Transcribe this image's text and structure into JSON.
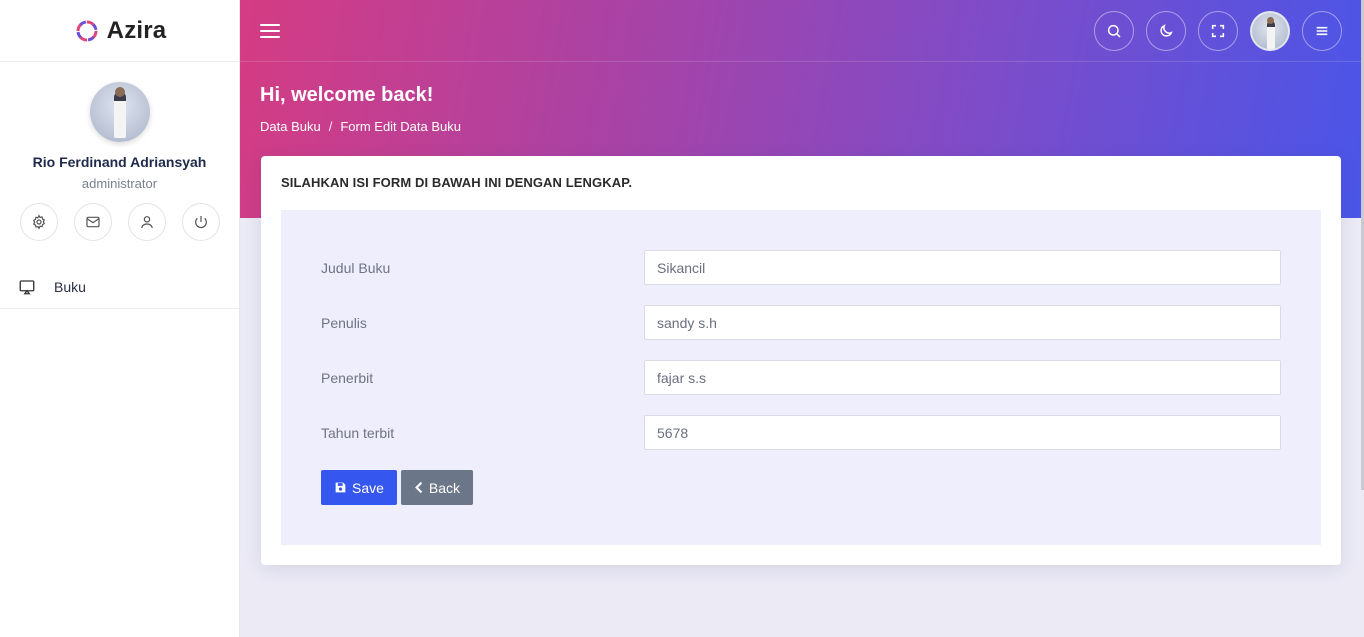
{
  "brand": {
    "name": "Azira"
  },
  "profile": {
    "name": "Rio Ferdinand Adriansyah",
    "role": "administrator"
  },
  "sidebar": {
    "items": [
      {
        "label": "Buku",
        "icon": "monitor-icon"
      }
    ]
  },
  "header": {
    "greeting": "Hi, welcome back!",
    "breadcrumb": [
      "Data Buku",
      "/",
      "Form Edit Data Buku"
    ]
  },
  "card": {
    "title": "SILAHKAN ISI FORM DI BAWAH INI DENGAN LENGKAP.",
    "fields": [
      {
        "label": "Judul Buku",
        "value": "Sikancil"
      },
      {
        "label": "Penulis",
        "value": "sandy s.h"
      },
      {
        "label": "Penerbit",
        "value": "fajar s.s"
      },
      {
        "label": "Tahun terbit",
        "value": "5678"
      }
    ],
    "save_label": "Save",
    "back_label": "Back"
  },
  "colors": {
    "accent": "#3656f0",
    "back": "#6c7689",
    "gradient_start": "#d53c83",
    "gradient_end": "#4a55e8"
  }
}
